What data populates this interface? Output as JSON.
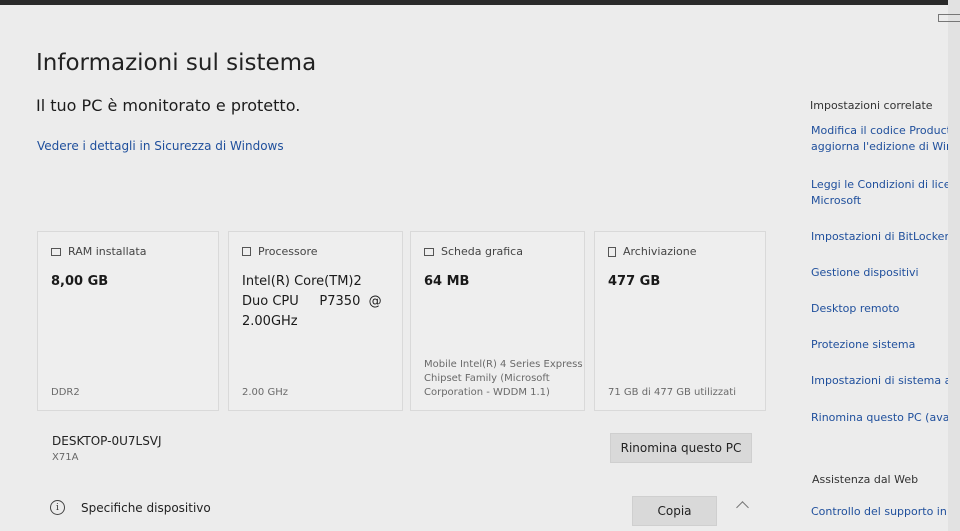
{
  "page": {
    "title": "Informazioni sul sistema",
    "status": "Il tuo PC è monitorato e protetto.",
    "security_link": "Vedere i dettagli in Sicurezza di Windows"
  },
  "cards": {
    "ram": {
      "label": "RAM installata",
      "value": "8,00 GB",
      "sub": "DDR2",
      "icon": "ram-icon"
    },
    "cpu": {
      "label": "Processore",
      "value_lines": [
        "Intel(R) Core(TM)2",
        "Duo CPU     P7350  @",
        "2.00GHz"
      ],
      "sub": "2.00 GHz",
      "icon": "processor-icon"
    },
    "gpu": {
      "label": "Scheda grafica",
      "value": "64 MB",
      "sub_lines": [
        "Mobile Intel(R) 4 Series Express",
        "Chipset Family (Microsoft",
        "Corporation - WDDM 1.1)"
      ],
      "icon": "graphics-card-icon"
    },
    "storage": {
      "label": "Archiviazione",
      "value": "477 GB",
      "sub": "71 GB di 477 GB utilizzati",
      "icon": "storage-icon"
    }
  },
  "device": {
    "name": "DESKTOP-0U7LSVJ",
    "model": "X71A",
    "rename_button": "Rinomina questo PC"
  },
  "specs": {
    "label": "Specifiche dispositivo",
    "copy_button": "Copia"
  },
  "related": {
    "title": "Impostazioni correlate",
    "links": [
      [
        "Modifica il codice Product",
        "aggiorna l'edizione di Wind"
      ],
      [
        "Leggi le Condizioni di licen",
        "Microsoft"
      ],
      [
        "Impostazioni di BitLocker"
      ],
      [
        "Gestione dispositivi"
      ],
      [
        "Desktop remoto"
      ],
      [
        "Protezione sistema"
      ],
      [
        "Impostazioni di sistema av"
      ],
      [
        "Rinomina questo PC (avan"
      ]
    ],
    "web_title": "Assistenza dal Web",
    "web_link": "Controllo del supporto in s"
  },
  "colors": {
    "link": "#1f4f9c",
    "background": "#ececec",
    "button": "#d9d9d9"
  }
}
